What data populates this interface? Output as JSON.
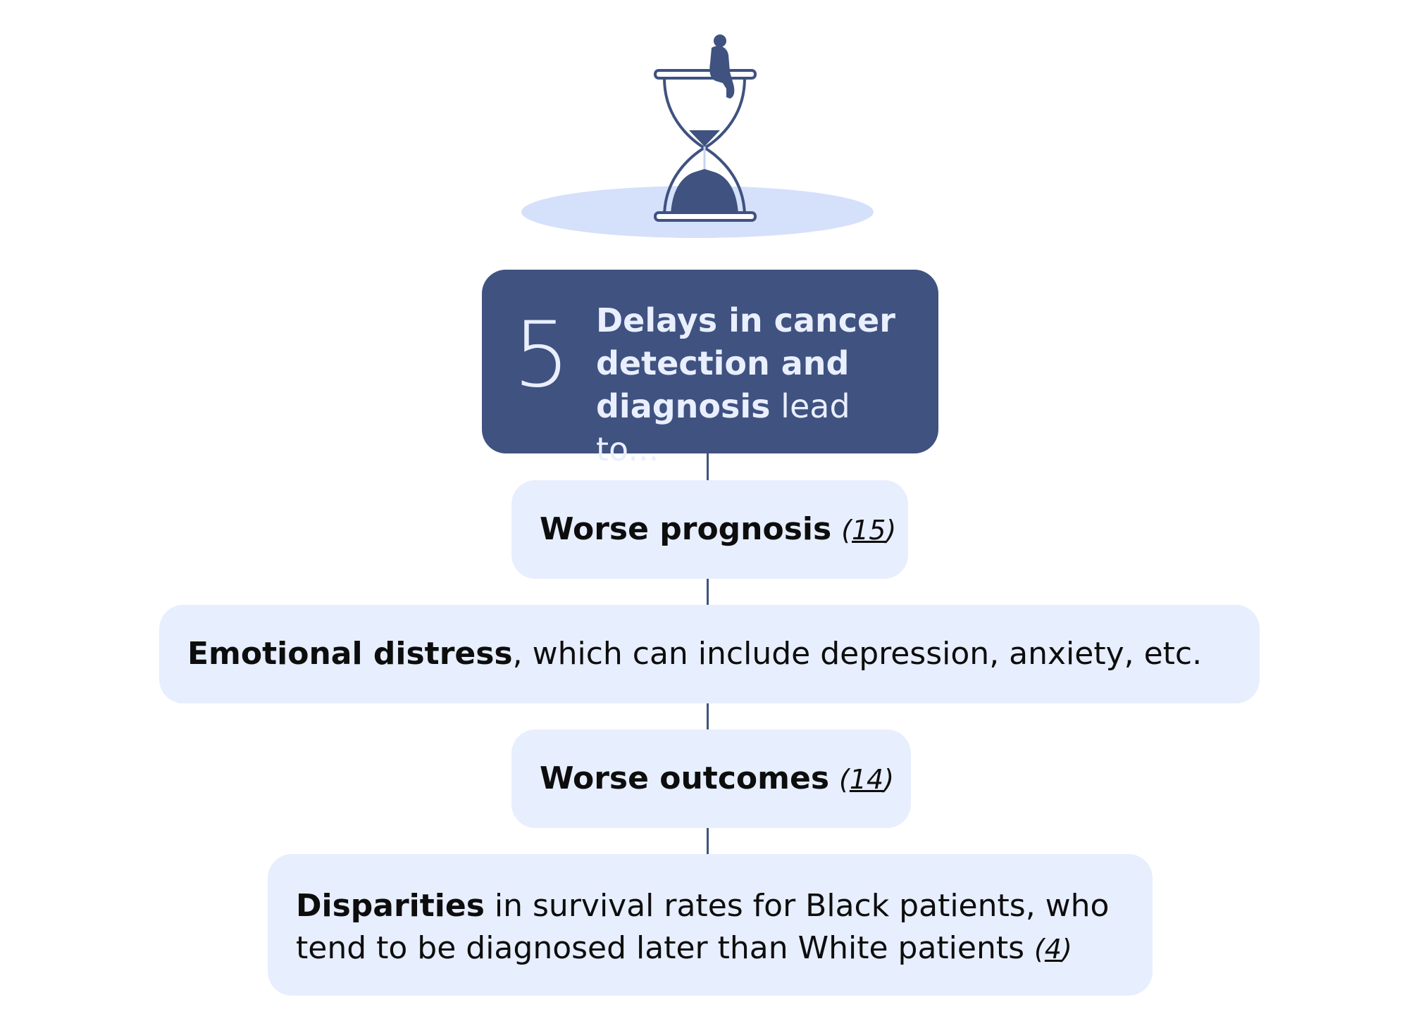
{
  "header": {
    "number": "5",
    "title_bold": "Delays in cancer detection and diagnosis",
    "title_rest": " lead to..."
  },
  "items": [
    {
      "bold": "Worse prognosis",
      "text": "",
      "cite_open": "(",
      "cite_num": "15",
      "cite_close": ")"
    },
    {
      "bold": "Emotional distress",
      "text": ", which can include depression, anxiety, etc.",
      "cite_open": "",
      "cite_num": "",
      "cite_close": ""
    },
    {
      "bold": "Worse outcomes",
      "text": "",
      "cite_open": "(",
      "cite_num": "14",
      "cite_close": ")"
    },
    {
      "bold": "Disparities",
      "text": " in survival rates for Black patients, who tend to be diagnosed later than White patients",
      "cite_open": "(",
      "cite_num": "4",
      "cite_close": ")"
    }
  ],
  "colors": {
    "header_bg": "#3f5280",
    "header_text": "#e9efff",
    "box_bg": "#e7eefd",
    "connector": "#3f5280",
    "shadow": "#d5e0fa"
  },
  "icons": {
    "illustration": "hourglass-with-seated-person-icon"
  }
}
